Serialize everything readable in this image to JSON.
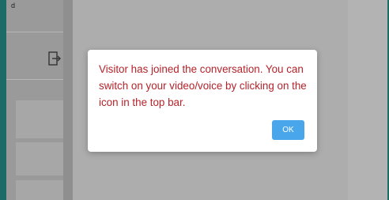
{
  "sidebar": {
    "top_text": "d"
  },
  "icons": {
    "logout": "logout-icon"
  },
  "dialog": {
    "message": "Visitor has joined the conversation. You can switch on your video/voice by clicking on the icon in the top bar.",
    "ok_label": "OK"
  },
  "colors": {
    "message_text": "#b4232a",
    "ok_button": "#4aa6ea",
    "outer_frame": "#1d6b66"
  }
}
